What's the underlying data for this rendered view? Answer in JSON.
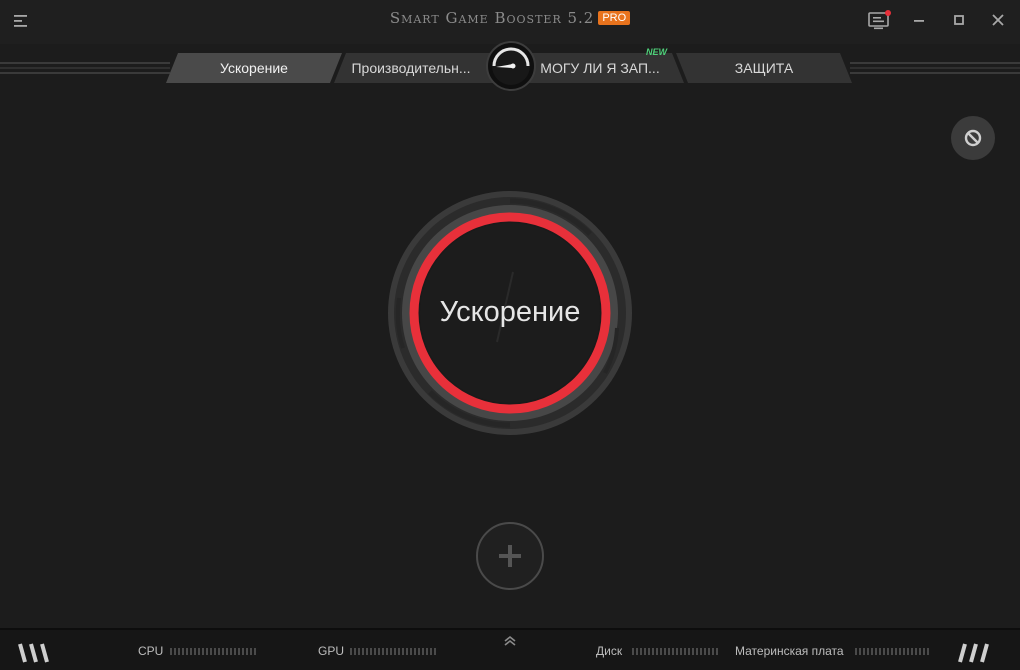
{
  "window": {
    "title": "Smart Game Booster 5.2",
    "badge": "PRO"
  },
  "tabs": [
    {
      "label": "Ускорение",
      "active": true
    },
    {
      "label": "Производительн...",
      "active": false
    },
    {
      "label": "МОГУ ЛИ Я ЗАП...",
      "active": false,
      "badge": "NEW"
    },
    {
      "label": "ЗАЩИТА",
      "active": false
    }
  ],
  "main": {
    "boost_label": "Ускорение",
    "accent_color": "#e8303a"
  },
  "status": {
    "cpu_label": "CPU",
    "gpu_label": "GPU",
    "disk_label": "Диск",
    "motherboard_label": "Материнская плата"
  },
  "icons": {
    "menu": "menu-icon",
    "notify": "monitor-notification-icon",
    "minimize": "minimize-icon",
    "maximize": "maximize-icon",
    "close": "close-icon",
    "gauge": "speedometer-icon",
    "block": "block-icon",
    "add": "plus-icon",
    "collapse": "chevron-up-icon"
  }
}
